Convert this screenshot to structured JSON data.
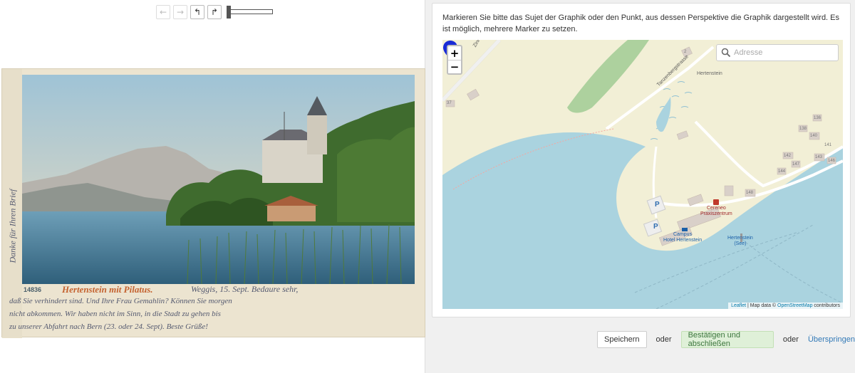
{
  "toolbar": {
    "buttons": [
      {
        "icon": "arrow-left-icon",
        "glyph": "←",
        "enabled": false
      },
      {
        "icon": "arrow-right-icon",
        "glyph": "→",
        "enabled": false
      },
      {
        "icon": "rotate-left-icon",
        "glyph": "↰",
        "enabled": true
      },
      {
        "icon": "rotate-right-icon",
        "glyph": "↱",
        "enabled": true
      }
    ],
    "zoom_slider_value": 0
  },
  "postcard": {
    "number": "14836",
    "caption": "Hertenstein mit Pilatus.",
    "handwriting_lines": [
      "Weggis, 15. Sept. Bedaure sehr,",
      "daß Sie verhindert sind. Und Ihre Frau Gemahlin? Können Sie morgen",
      "nicht abkommen. Wir haben nicht im Sinn, in die Stadt zu gehen bis",
      "zu unserer Abfahrt nach Bern (23. oder 24. Sept). Beste Grüße!"
    ],
    "side_text": "Danke für Ihren Brief"
  },
  "instructions": "Markieren Sie bitte das Sujet der Graphik oder den Punkt, aus dessen Perspektive die Graphik dargestellt wird. Es ist möglich, mehrere Marker zu setzen.",
  "map": {
    "zoom_in": "+",
    "zoom_out": "−",
    "search_placeholder": "Adresse",
    "labels": {
      "street1": "Zinnenstrasse",
      "street2": "Tanzenbergstrasse",
      "place": "Hertenstein",
      "poi1": "Cereneo",
      "poi1b": "Praxiszentrum",
      "poi2": "Campus",
      "poi2b": "Hotel Hertenstein",
      "poi3": "Hertenstein",
      "poi3b": "(See)",
      "parking": "P",
      "house_numbers": [
        "2",
        "37",
        "136",
        "138",
        "140",
        "142",
        "143",
        "144",
        "146",
        "147",
        "148",
        "141"
      ]
    },
    "attribution": {
      "leaflet": "Leaflet",
      "sep": " | Map data © ",
      "osm": "OpenStreetMap",
      "tail": " contributors"
    },
    "colors": {
      "water": "#aad3df",
      "land": "#f2efd6",
      "forest": "#add19e",
      "marker": "#1a2bd6"
    }
  },
  "actions": {
    "save": "Speichern",
    "or1": "oder",
    "confirm": "Bestätigen und abschließen",
    "or2": "oder",
    "skip": "Überspringen"
  }
}
